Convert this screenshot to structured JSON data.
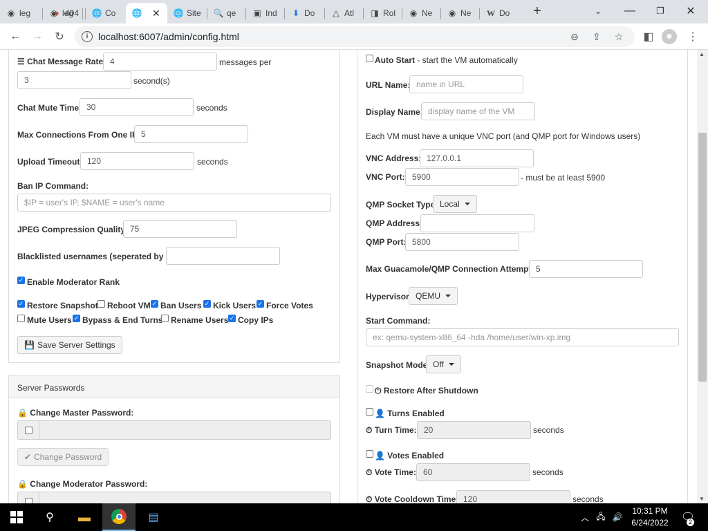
{
  "browser": {
    "tabs": [
      {
        "label": "leg",
        "icon": "github-icon"
      },
      {
        "label": "404",
        "icon": "avatar-icon"
      },
      {
        "label": "Co",
        "icon": "globe-icon"
      },
      {
        "label": "",
        "icon": "globe-icon",
        "active": true
      },
      {
        "label": "Site",
        "icon": "globe-icon"
      },
      {
        "label": "qe",
        "icon": "search-icon"
      },
      {
        "label": "Ind",
        "icon": "site-icon"
      },
      {
        "label": "Do",
        "icon": "download-icon"
      },
      {
        "label": "Atl",
        "icon": "atlassian-icon"
      },
      {
        "label": "Rol",
        "icon": "site-icon"
      },
      {
        "label": "Ne",
        "icon": "github-icon"
      },
      {
        "label": "Ne",
        "icon": "github-icon"
      },
      {
        "label": "Do",
        "icon": "wikipedia-icon"
      }
    ],
    "url": "localhost:6007/admin/config.html"
  },
  "left": {
    "chat_rate_label": "Chat Message Rate:",
    "chat_rate_value": "4",
    "chat_rate_unit": "messages per",
    "chat_rate_seconds_value": "3",
    "chat_rate_seconds_unit": "second(s)",
    "mute_label": "Chat Mute Time:",
    "mute_value": "30",
    "mute_unit": "seconds",
    "maxconn_label": "Max Connections From One IP:",
    "maxconn_value": "5",
    "upload_label": "Upload Timeout:",
    "upload_value": "120",
    "upload_unit": "seconds",
    "ban_label": "Ban IP Command:",
    "ban_placeholder": "$IP = user's IP, $NAME = user's name",
    "jpeg_label": "JPEG Compression Quality:",
    "jpeg_value": "75",
    "blacklist_label": "Blacklisted usernames (seperated by ;):",
    "blacklist_value": "",
    "enable_mod_label": "Enable Moderator Rank",
    "enable_mod_checked": true,
    "perms": [
      {
        "label": "Restore Snapshot",
        "checked": true
      },
      {
        "label": "Reboot VM",
        "checked": false
      },
      {
        "label": "Ban Users",
        "checked": true
      },
      {
        "label": "Kick Users",
        "checked": true
      },
      {
        "label": "Force Votes",
        "checked": true
      },
      {
        "label": "Mute Users",
        "checked": false
      },
      {
        "label": "Bypass & End Turns",
        "checked": true
      },
      {
        "label": "Rename Users",
        "checked": false
      },
      {
        "label": "Copy IPs",
        "checked": true
      }
    ],
    "save_label": "Save Server Settings",
    "passwords_header": "Server Passwords",
    "master_pw_label": "Change Master Password:",
    "change_pw_label": "Change Password",
    "mod_pw_label": "Change Moderator Password:"
  },
  "right": {
    "autostart_label": "Auto Start",
    "autostart_desc": " - start the VM automatically",
    "url_name_label": "URL Name:",
    "url_name_placeholder": "name in URL",
    "display_name_label": "Display Name:",
    "display_name_placeholder": "display name of the VM",
    "vnc_note": "Each VM must have a unique VNC port (and QMP port for Windows users)",
    "vnc_addr_label": "VNC Address:",
    "vnc_addr_value": "127.0.0.1",
    "vnc_port_label": "VNC Port:",
    "vnc_port_value": "5900",
    "vnc_port_note": "- must be at least 5900",
    "qmp_type_label": "QMP Socket Type:",
    "qmp_type_value": "Local",
    "qmp_addr_label": "QMP Address:",
    "qmp_addr_value": "",
    "qmp_port_label": "QMP Port:",
    "qmp_port_value": "5800",
    "max_attempts_label": "Max Guacamole/QMP Connection Attempts:",
    "max_attempts_value": "5",
    "hypervisor_label": "Hypervisor:",
    "hypervisor_value": "QEMU",
    "start_cmd_label": "Start Command:",
    "start_cmd_placeholder": "ex: qemu-system-x86_64 -hda /home/user/win-xp.img",
    "snapshot_label": "Snapshot Mode:",
    "snapshot_value": "Off",
    "restore_label": "Restore After Shutdown",
    "turns_label": "Turns Enabled",
    "turn_time_label": "Turn Time:",
    "turn_time_value": "20",
    "turn_time_unit": "seconds",
    "votes_label": "Votes Enabled",
    "vote_time_label": "Vote Time:",
    "vote_time_value": "60",
    "vote_time_unit": "seconds",
    "vote_cd_label": "Vote Cooldown Time:",
    "vote_cd_value": "120",
    "vote_cd_unit": "seconds"
  },
  "taskbar": {
    "time": "10:31 PM",
    "date": "6/24/2022",
    "notifications": "2"
  }
}
